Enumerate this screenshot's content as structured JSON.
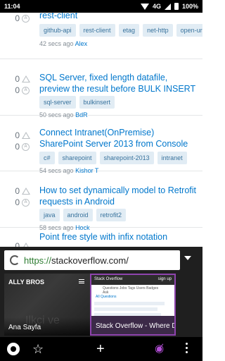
{
  "status_bar": {
    "time": "11:04",
    "network": "4G",
    "battery": "100%"
  },
  "questions": [
    {
      "votes": "0",
      "answers": "0",
      "title": "rest-client",
      "tags": [
        "github-api",
        "rest-client",
        "etag",
        "net-http",
        "open-uri"
      ],
      "time": "42 secs ago",
      "user": "Alex"
    },
    {
      "votes": "0",
      "answers": "0",
      "title": "SQL Server, fixed length datafile, preview the result before BULK INSERT",
      "tags": [
        "sql-server",
        "bulkinsert"
      ],
      "time": "50 secs ago",
      "user": "BdR"
    },
    {
      "votes": "0",
      "answers": "0",
      "title": "Connect Intranet(OnPremise) SharePoint Server 2013 from Console C#",
      "tags": [
        "c#",
        "sharepoint",
        "sharepoint-2013",
        "intranet"
      ],
      "time": "54 secs ago",
      "user": "Kishor T"
    },
    {
      "votes": "0",
      "answers": "0",
      "title": "How to set dynamically model to Retrofit requests in Android",
      "tags": [
        "java",
        "android",
        "retrofit2"
      ],
      "time": "58 secs ago",
      "user": "Hock"
    },
    {
      "votes": "0",
      "answers": "0",
      "title": "Point free style with infix notation",
      "tags": [],
      "time": "",
      "user": ""
    }
  ],
  "browser": {
    "url_scheme": "https://",
    "url_rest": "stackoverflow.com/",
    "tabs": [
      {
        "label": "Ana Sayfa",
        "brand": "ALLY BROS",
        "watermark": "Ilkçi ve"
      },
      {
        "label": "Stack Overflow - Where Developers Learn",
        "header": "Stack Overflow",
        "header_right": "sign up",
        "nav": "Questions  Jobs  Tags  Users  Badges  Ask",
        "first_line": "All Questions"
      }
    ],
    "accent_color": "#8e44ad"
  }
}
